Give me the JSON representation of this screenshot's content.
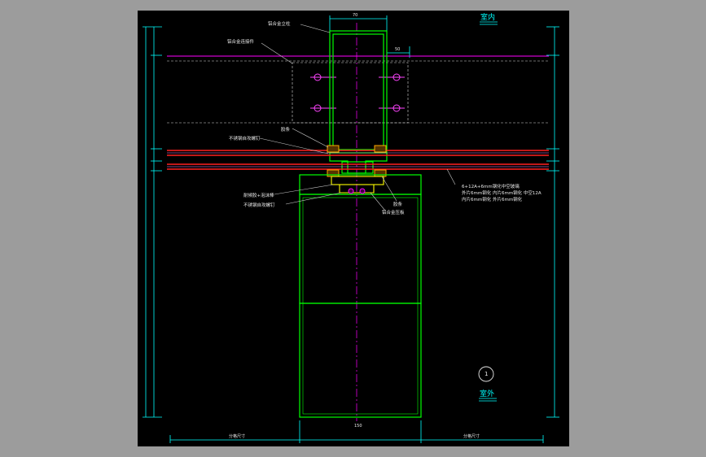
{
  "labels": {
    "top_interior": "室内",
    "bottom_exterior": "室外",
    "detail_number": "1"
  },
  "callouts": {
    "mullion": "铝合金立柱",
    "bracket": "铝合金连接件",
    "gasket_top": "胶条",
    "screw": "不锈钢自攻螺钉",
    "sealant_rod": "耐候胶+泡沫棒",
    "screw_bottom": "不锈钢自攻螺钉",
    "gasket_bottom": "胶条",
    "pressure_plate": "铝合金压板",
    "glass_line1": "6+12A+6mm钢化中空玻璃",
    "glass_line2": "外片6mm钢化 内片6mm钢化 中空12A",
    "glass_line3": "内片6mm钢化 外片6mm钢化"
  },
  "dimensions": {
    "bottom_left": "分格尺寸",
    "bottom_right": "分格尺寸",
    "bottom_center": "150",
    "top_mullion": "70",
    "top_offset": "50"
  },
  "colors": {
    "frame_bg": "#000000",
    "outer_bg": "#9c9c9c",
    "profile": "#00ff00",
    "glass": "#ff0000",
    "center_line": "#ff00ff",
    "dimension": "#00ffff"
  }
}
